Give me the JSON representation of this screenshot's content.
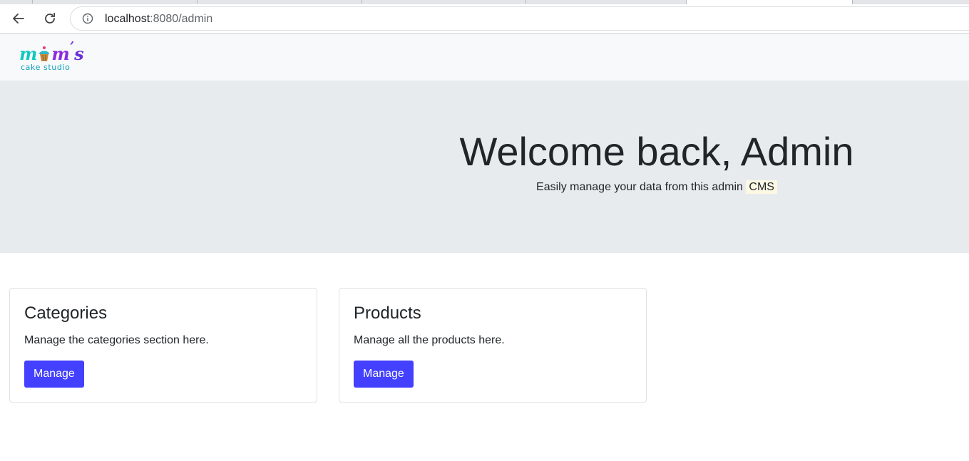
{
  "browser": {
    "url_host": "localhost",
    "url_rest": ":8080/admin"
  },
  "brand": {
    "logo_letter_1": "m",
    "logo_letter_2": "m",
    "logo_apostrophe": "’",
    "logo_letter_3": "s",
    "logo_subtitle": "cake studio"
  },
  "hero": {
    "title": "Welcome back, Admin",
    "subtitle": "Easily manage your data from this admin",
    "highlight": "CMS"
  },
  "cards": [
    {
      "title": "Categories",
      "text": "Manage the categories section here.",
      "button": "Manage"
    },
    {
      "title": "Products",
      "text": "Manage all the products here.",
      "button": "Manage"
    }
  ],
  "colors": {
    "accent_button": "#4340ff",
    "navbar_bg": "#f8f9fa",
    "hero_bg": "#e8ebee",
    "highlight_bg": "#fcf8e3"
  },
  "icons": {
    "back": "arrow-left-icon",
    "reload": "reload-icon",
    "info": "info-icon",
    "cupcake": "cupcake-icon"
  }
}
